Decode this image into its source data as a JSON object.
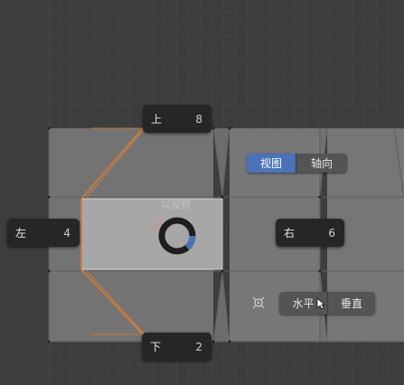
{
  "pie_menu": {
    "top": {
      "label": "上",
      "key": "8"
    },
    "left": {
      "label": "左",
      "key": "4"
    },
    "right": {
      "label": "右",
      "key": "6"
    },
    "bottom": {
      "label": "下",
      "key": "2"
    }
  },
  "view_toggle": {
    "options": [
      {
        "label": "视图",
        "active": true
      },
      {
        "label": "轴向",
        "active": false
      }
    ]
  },
  "align_toggle": {
    "options": [
      {
        "label": "水平",
        "active": false
      },
      {
        "label": "垂直",
        "active": false
      }
    ]
  },
  "faded_label": "以视野",
  "colors": {
    "background": "#3d3d3d",
    "mesh_face": "#777777",
    "selected_face": "#a6a6a6",
    "edge_selected": "#e07a2a",
    "accent": "#4a73b8",
    "button_bg": "#262626"
  }
}
